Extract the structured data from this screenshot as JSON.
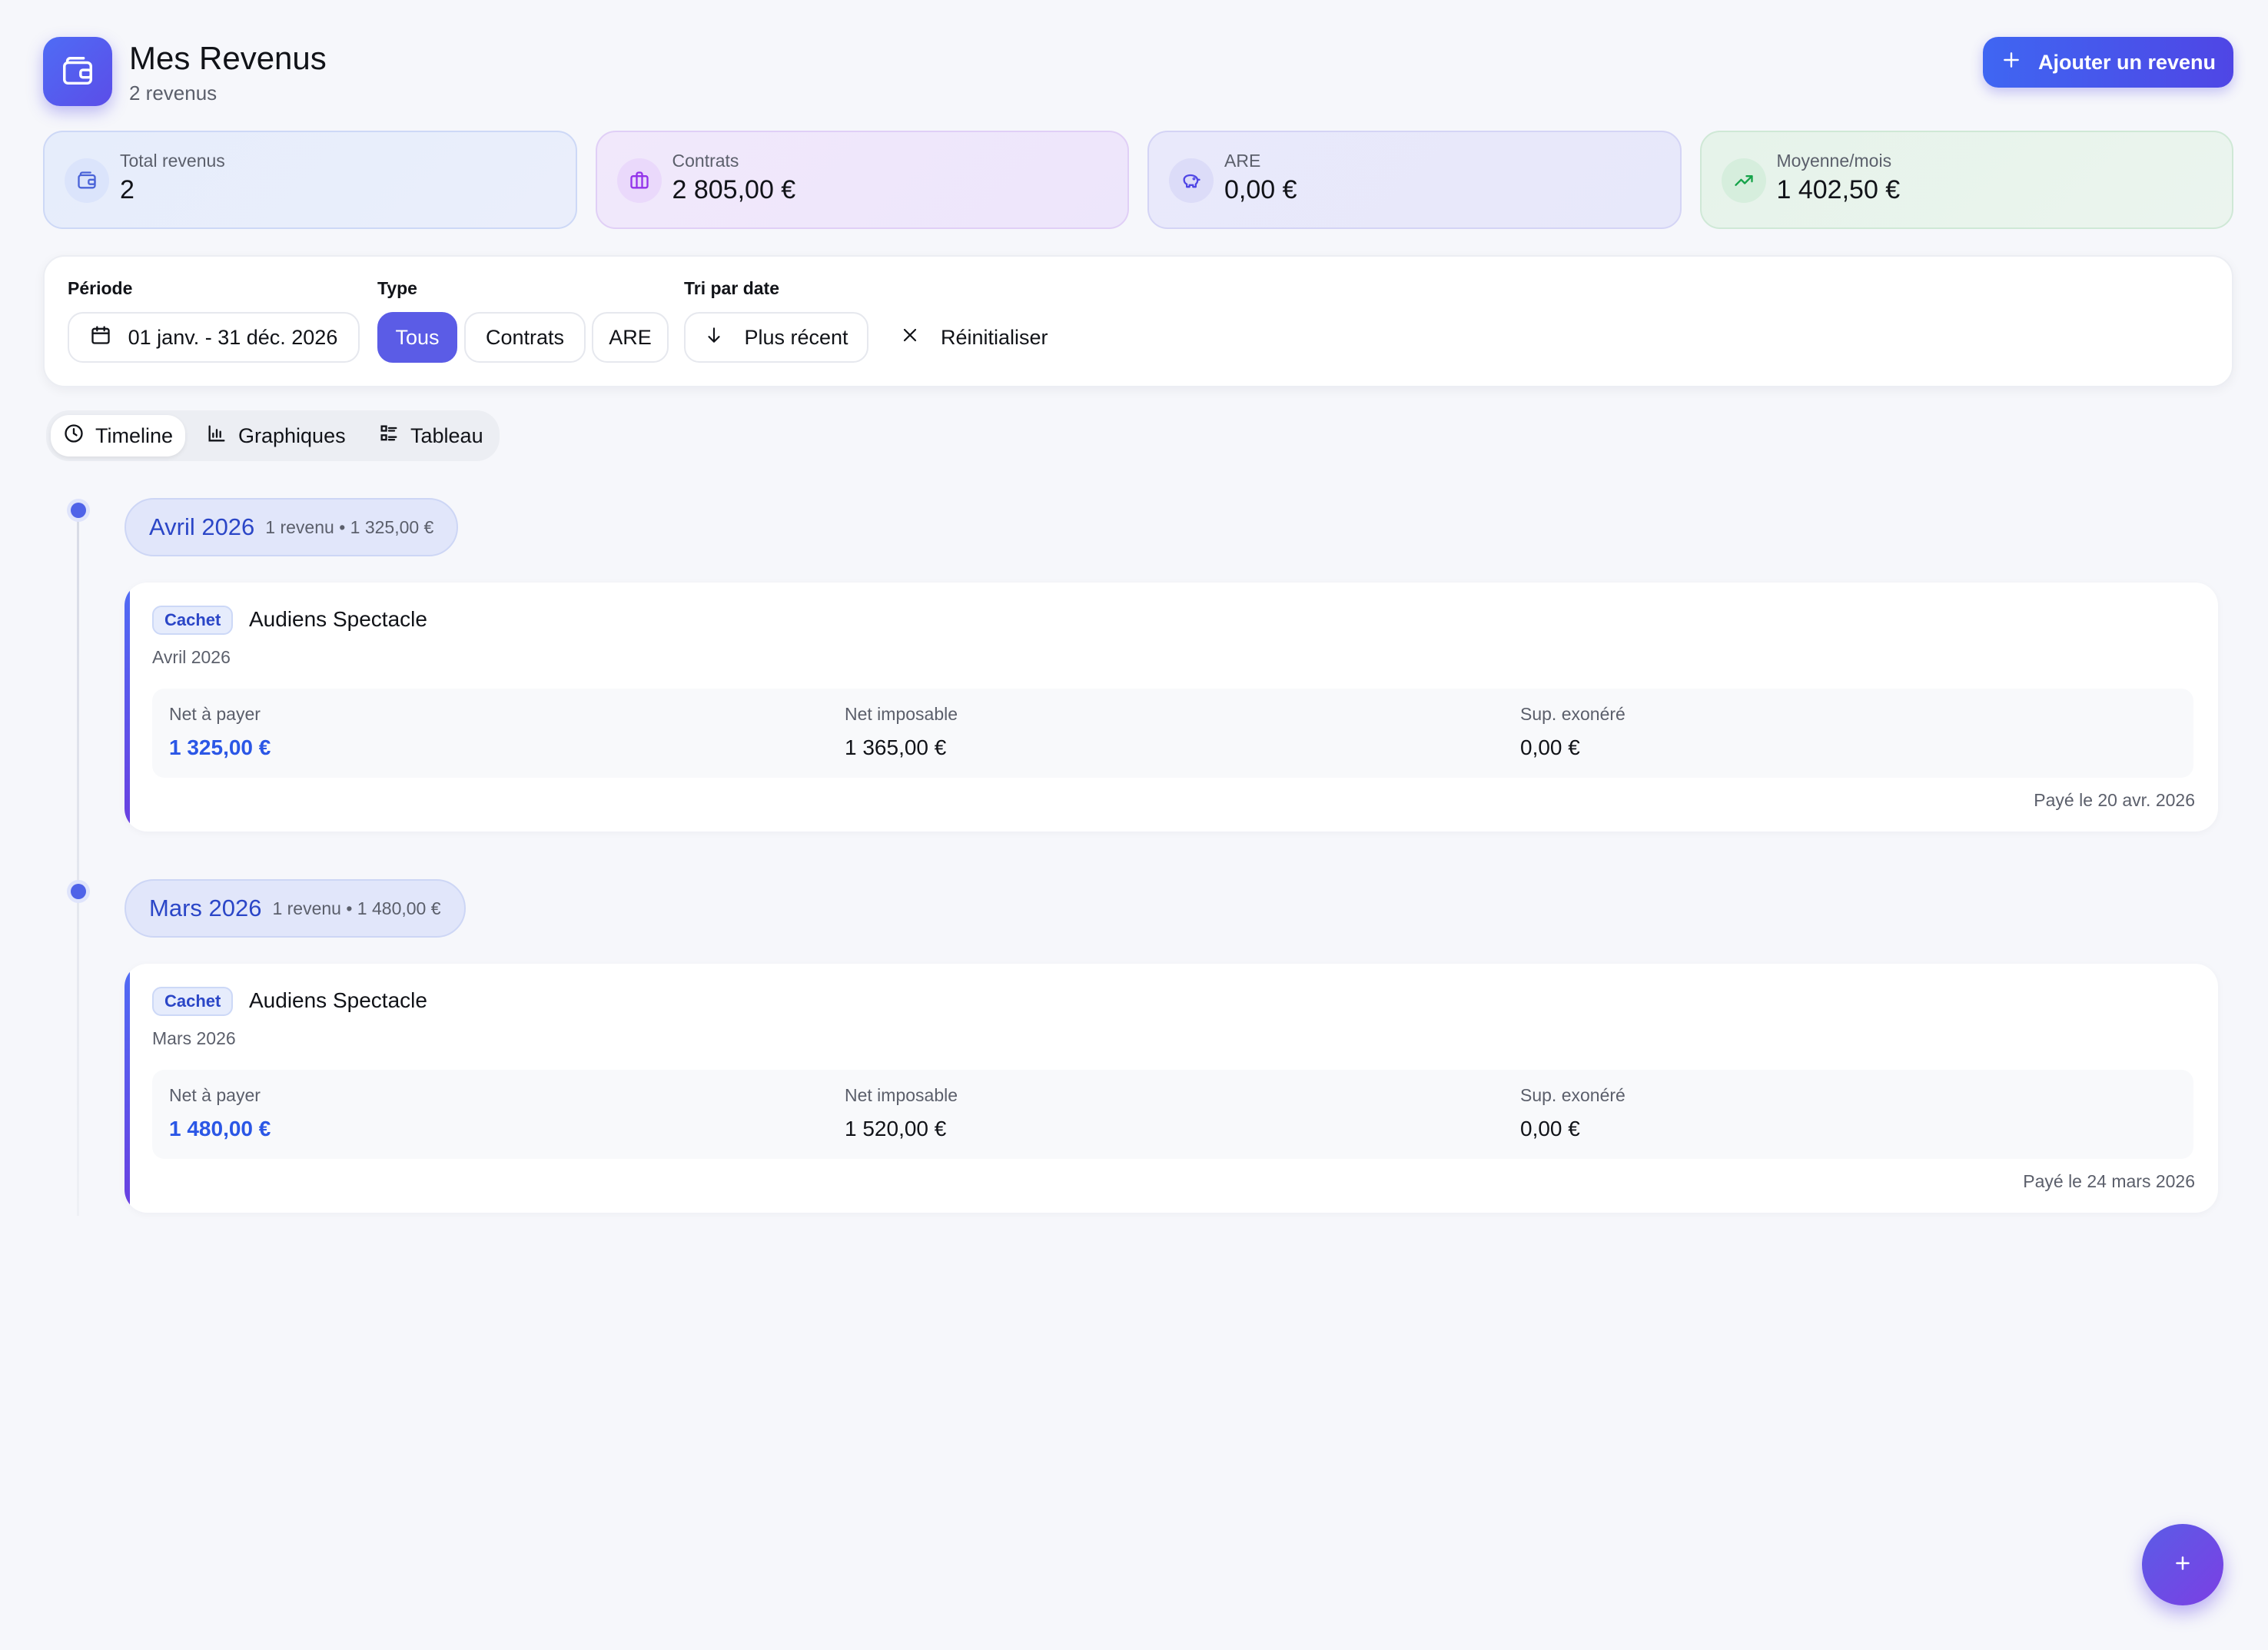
{
  "header": {
    "title": "Mes Revenus",
    "subtitle": "2 revenus",
    "add_label": "Ajouter un revenu"
  },
  "stats": [
    {
      "label": "Total revenus",
      "value": "2",
      "icon": "wallet-icon"
    },
    {
      "label": "Contrats",
      "value": "2 805,00 €",
      "icon": "briefcase-icon"
    },
    {
      "label": "ARE",
      "value": "0,00 €",
      "icon": "piggy-bank-icon"
    },
    {
      "label": "Moyenne/mois",
      "value": "1 402,50 €",
      "icon": "trending-up-icon"
    }
  ],
  "filters": {
    "period_label": "Période",
    "period_value": "01 janv. - 31 déc. 2026",
    "type_label": "Type",
    "type_options": [
      "Tous",
      "Contrats",
      "ARE"
    ],
    "type_selected": "Tous",
    "sort_label": "Tri par date",
    "sort_value": "Plus récent",
    "reset_label": "Réinitialiser"
  },
  "tabs": [
    {
      "label": "Timeline",
      "icon": "clock-icon",
      "active": true
    },
    {
      "label": "Graphiques",
      "icon": "bar-chart-icon",
      "active": false
    },
    {
      "label": "Tableau",
      "icon": "list-icon",
      "active": false
    }
  ],
  "timeline": [
    {
      "month": "Avril 2026",
      "summary": "1 revenu • 1 325,00 €",
      "entry": {
        "tag": "Cachet",
        "payer": "Audiens Spectacle",
        "month": "Avril 2026",
        "net_label": "Net à payer",
        "net_value": "1 325,00 €",
        "taxable_label": "Net imposable",
        "taxable_value": "1 365,00 €",
        "exempt_label": "Sup. exonéré",
        "exempt_value": "0,00 €",
        "paid": "Payé le 20 avr. 2026"
      }
    },
    {
      "month": "Mars 2026",
      "summary": "1 revenu • 1 480,00 €",
      "entry": {
        "tag": "Cachet",
        "payer": "Audiens Spectacle",
        "month": "Mars 2026",
        "net_label": "Net à payer",
        "net_value": "1 480,00 €",
        "taxable_label": "Net imposable",
        "taxable_value": "1 520,00 €",
        "exempt_label": "Sup. exonéré",
        "exempt_value": "0,00 €",
        "paid": "Payé le 24 mars 2026"
      }
    }
  ],
  "colors": {
    "accent": "#5b5ce6",
    "brand_blue": "#2b46c7",
    "net_blue": "#2b57e6"
  }
}
